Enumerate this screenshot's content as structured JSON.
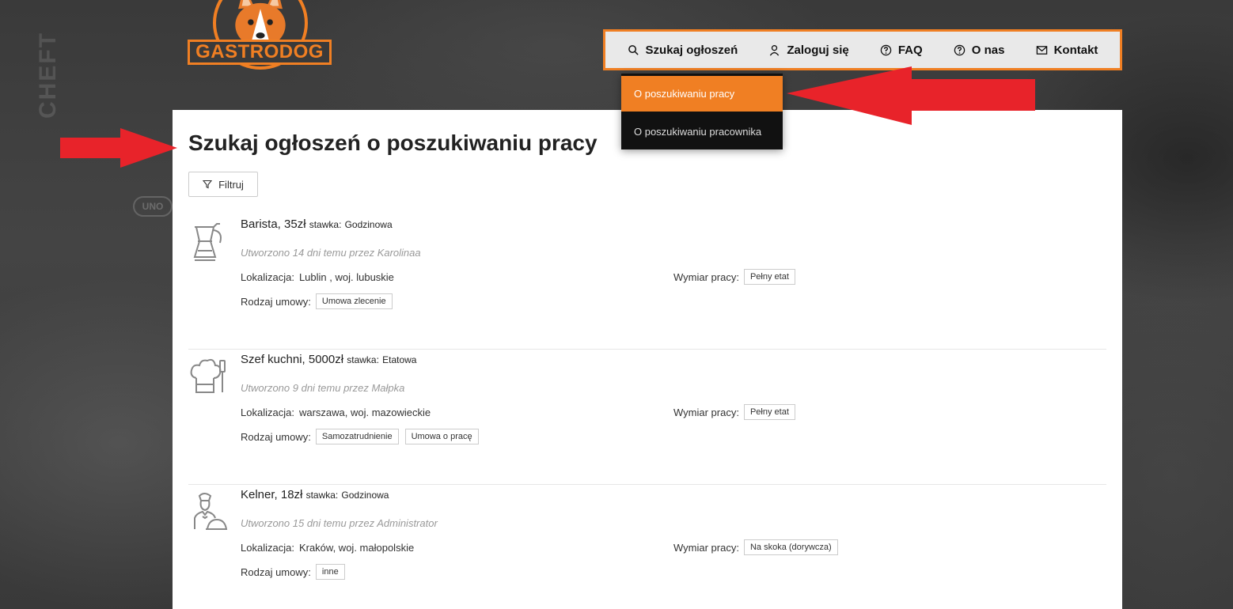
{
  "brand": {
    "logo_text": "GASTRODOG",
    "accent": "#f07f23"
  },
  "background": {
    "text_1": "CHEFT",
    "text_2": "UNO"
  },
  "nav": [
    {
      "label": "Szukaj ogłoszeń",
      "icon": "search-icon"
    },
    {
      "label": "Zaloguj się",
      "icon": "user-icon"
    },
    {
      "label": "FAQ",
      "icon": "question-icon"
    },
    {
      "label": "O nas",
      "icon": "question-icon"
    },
    {
      "label": "Kontakt",
      "icon": "mail-icon"
    }
  ],
  "dropdown": [
    {
      "label": "O poszukiwaniu pracy",
      "active": true
    },
    {
      "label": "O poszukiwaniu pracownika",
      "active": false
    }
  ],
  "page": {
    "title": "Szukaj ogłoszeń o poszukiwaniu pracy",
    "filter_label": "Filtruj"
  },
  "labels": {
    "location": "Lokalizacja",
    "contract": "Rodzaj umowy",
    "workload": "Wymiar pracy",
    "separator": ":"
  },
  "offers": [
    {
      "title": "Barista, 35zł",
      "rate_label": "stawka:",
      "rate": "Godzinowa",
      "created": "Utworzono 14 dni temu przez Karolinaa",
      "location": "Lublin , woj. lubuskie",
      "contracts": [
        "Umowa zlecenie"
      ],
      "workload": "Pełny etat",
      "icon": "coffee-maker-icon"
    },
    {
      "title": "Szef kuchni, 5000zł",
      "rate_label": "stawka:",
      "rate": "Etatowa",
      "created": "Utworzono 9 dni temu przez Małpka",
      "location": "warszawa, woj. mazowieckie",
      "contracts": [
        "Samozatrudnienie",
        "Umowa o pracę"
      ],
      "workload": "Pełny etat",
      "icon": "chef-hat-icon"
    },
    {
      "title": "Kelner, 18zł",
      "rate_label": "stawka:",
      "rate": "Godzinowa",
      "created": "Utworzono 15 dni temu przez Administrator",
      "location": "Kraków, woj. małopolskie",
      "contracts": [
        "inne"
      ],
      "workload": "Na skoka (dorywcza)",
      "icon": "waiter-icon"
    }
  ]
}
